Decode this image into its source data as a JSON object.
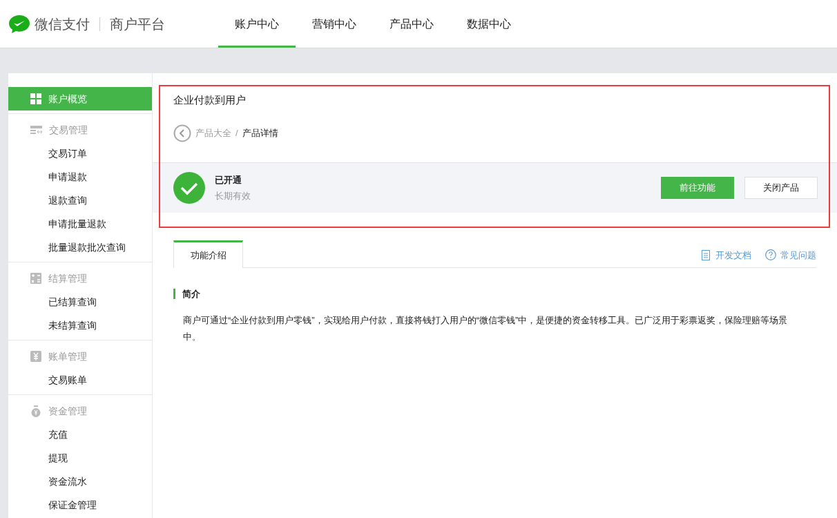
{
  "brand": {
    "name": "微信支付",
    "product": "商户平台"
  },
  "nav": [
    {
      "label": "账户中心",
      "selected": true
    },
    {
      "label": "营销中心",
      "selected": false
    },
    {
      "label": "产品中心",
      "selected": false
    },
    {
      "label": "数据中心",
      "selected": false
    }
  ],
  "sidebar": {
    "overview": {
      "label": "账户概览",
      "selected": true
    },
    "groups": [
      {
        "title": "交易管理",
        "items": [
          {
            "label": "交易订单",
            "selected": false
          },
          {
            "label": "申请退款",
            "selected": false
          },
          {
            "label": "退款查询",
            "selected": false
          },
          {
            "label": "申请批量退款",
            "selected": false
          },
          {
            "label": "批量退款批次查询",
            "selected": false
          }
        ]
      },
      {
        "title": "结算管理",
        "items": [
          {
            "label": "已结算查询",
            "selected": false
          },
          {
            "label": "未结算查询",
            "selected": false
          }
        ]
      },
      {
        "title": "账单管理",
        "items": [
          {
            "label": "交易账单",
            "selected": false
          }
        ]
      },
      {
        "title": "资金管理",
        "items": [
          {
            "label": "充值",
            "selected": false
          },
          {
            "label": "提现",
            "selected": false
          },
          {
            "label": "资金流水",
            "selected": false
          },
          {
            "label": "保证金管理",
            "selected": false
          }
        ]
      }
    ]
  },
  "product": {
    "title": "企业付款到用户",
    "breadcrumb": [
      "产品大全",
      "产品详情"
    ],
    "breadcrumb_separator": "/",
    "status": "已开通",
    "validity": "长期有效",
    "buttons": [
      {
        "label": "前往功能",
        "kind": "primary"
      },
      {
        "label": "关闭产品",
        "kind": "secondary"
      }
    ]
  },
  "tabs": [
    {
      "label": "功能介绍",
      "selected": true
    }
  ],
  "links": [
    {
      "label": "开发文档",
      "kind": "doc"
    },
    {
      "label": "常见问题",
      "kind": "help"
    }
  ],
  "intro": {
    "heading": "简介",
    "text": "商户可通过“企业付款到用户零钱”，实现给用户付款，直接将钱打入用户的“微信零钱”中，是便捷的资金转移工具。已广泛用于彩票返奖，保险理赔等场景中。"
  }
}
